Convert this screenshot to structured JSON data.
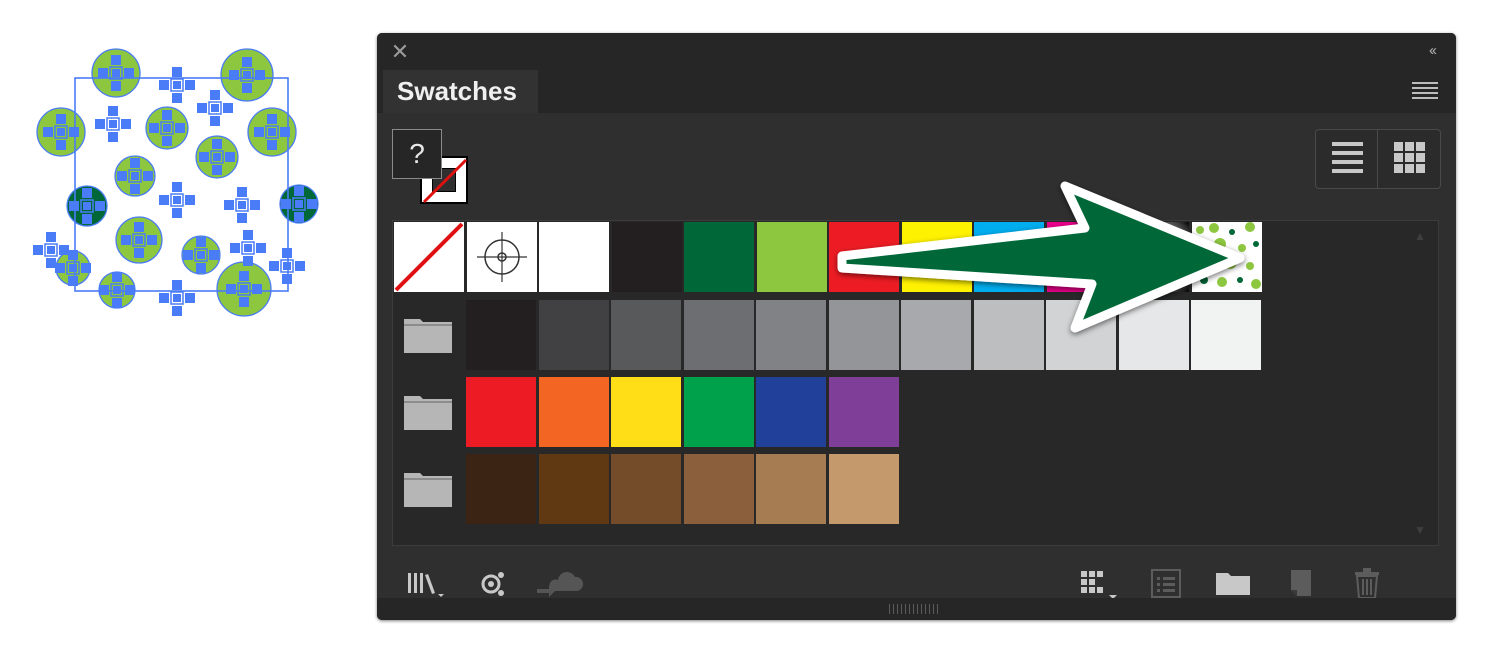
{
  "panel": {
    "tab_label": "Swatches",
    "close_glyph": "✕",
    "collapse_glyph": "‹‹",
    "fill_none_glyph": "?"
  },
  "swatches": {
    "row1": [
      {
        "name": "none",
        "color": "#ffffff"
      },
      {
        "name": "registration",
        "color": "#ffffff"
      },
      {
        "name": "white",
        "color": "#ffffff"
      },
      {
        "name": "black",
        "color": "#231f20"
      },
      {
        "name": "dark-green",
        "color": "#006838"
      },
      {
        "name": "light-green",
        "color": "#8dc63f"
      },
      {
        "name": "red",
        "color": "#ed1c24"
      },
      {
        "name": "yellow",
        "color": "#fff200"
      },
      {
        "name": "cyan",
        "color": "#00aeef"
      },
      {
        "name": "magenta",
        "color": "#ec008c"
      },
      {
        "name": "radial-gradient",
        "color": "#000000"
      },
      {
        "name": "dots-pattern",
        "color": "#8dc63f"
      }
    ],
    "grays": [
      "#231f20",
      "#414042",
      "#58595b",
      "#6d6e71",
      "#808285",
      "#939598",
      "#a7a9ac",
      "#bcbec0",
      "#d1d3d4",
      "#e6e7e8",
      "#f1f2f2"
    ],
    "brights": [
      "#ed1c24",
      "#f26522",
      "#ffde17",
      "#00a14b",
      "#21409a",
      "#7f3f98"
    ],
    "browns": [
      "#3c2415",
      "#603913",
      "#754c29",
      "#8b5e3c",
      "#a67c52",
      "#c49a6c"
    ]
  },
  "icons": {
    "artwork": "pattern-artwork",
    "arrow": "green-arrow-annotation"
  }
}
